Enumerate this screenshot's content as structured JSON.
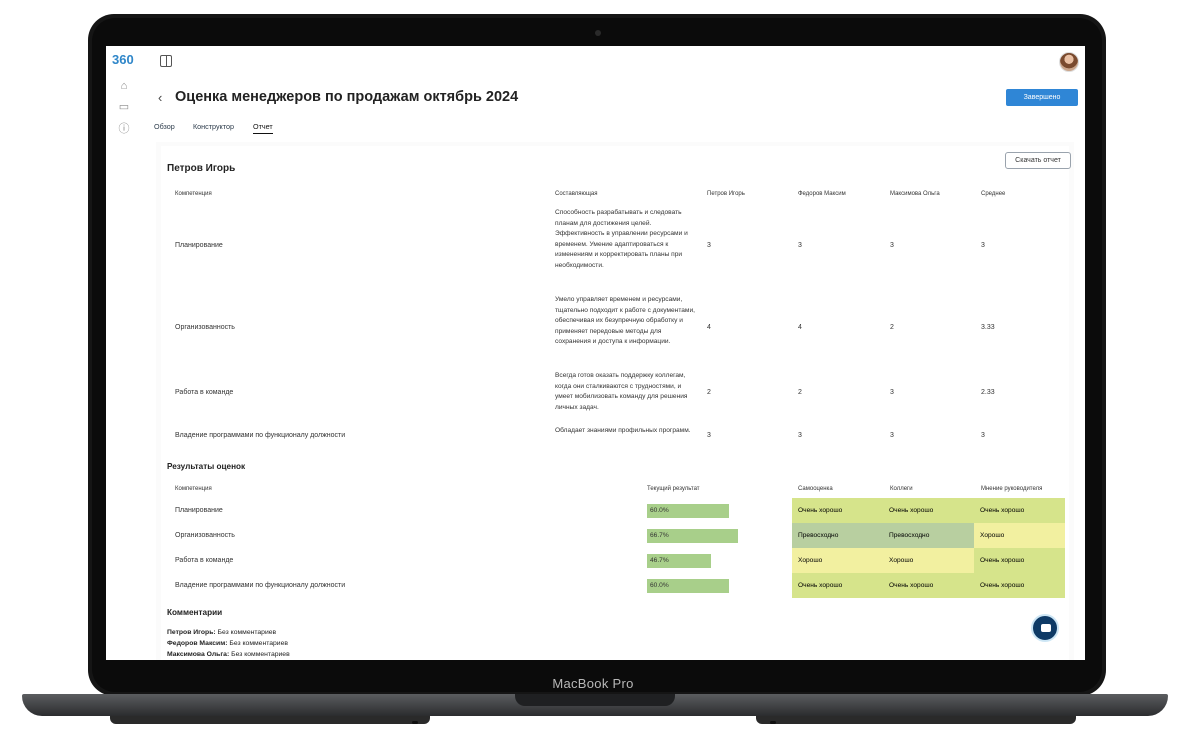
{
  "app": {
    "logo": "360",
    "title": "Оценка менеджеров по продажам октябрь 2024",
    "status_button": "Завершено"
  },
  "tabs": [
    {
      "label": "Обзор"
    },
    {
      "label": "Конструктор"
    },
    {
      "label": "Отчет"
    }
  ],
  "report": {
    "person": "Петров Игорь",
    "download_button": "Скачать отчет",
    "headers": [
      "Компетенция",
      "Составляющая",
      "Петров Игорь",
      "Федоров Максим",
      "Максимова Ольга",
      "Среднее"
    ],
    "rows": [
      {
        "competence": "Планирование",
        "desc": "Способность разрабатывать и следовать планам для достижения целей. Эффективность в управлении ресурсами и временем. Умение адаптироваться к изменениям и корректировать планы при необходимости.",
        "petrov": "3",
        "fedorov": "3",
        "maksimova": "3",
        "avg": "3"
      },
      {
        "competence": "Организованность",
        "desc": "Умело управляет временем и ресурсами, тщательно подходит к работе с документами, обеспечивая их безупречную обработку и применяет передовые методы для сохранения и доступа к информации.",
        "petrov": "4",
        "fedorov": "4",
        "maksimova": "2",
        "avg": "3.33"
      },
      {
        "competence": "Работа в команде",
        "desc": "Всегда готов оказать поддержку коллегам, когда они сталкиваются с трудностями, и умеет мобилизовать команду для решения личных задач.",
        "petrov": "2",
        "fedorov": "2",
        "maksimova": "3",
        "avg": "2.33"
      },
      {
        "competence": "Владение программами по функционалу должности",
        "desc": "Обладает знаниями профильных программ.",
        "petrov": "3",
        "fedorov": "3",
        "maksimova": "3",
        "avg": "3"
      }
    ]
  },
  "results": {
    "section_title": "Результаты оценок",
    "headers": [
      "Компетенция",
      "Текущий результат",
      "Самооценка",
      "Коллеги",
      "Мнение руководителя"
    ],
    "rows": [
      {
        "competence": "Планирование",
        "current": "60.0%",
        "current_value": 60.0,
        "self": "Очень хорошо",
        "peers": "Очень хорошо",
        "manager": "Очень хорошо"
      },
      {
        "competence": "Организованность",
        "current": "66.7%",
        "current_value": 66.7,
        "self": "Превосходно",
        "peers": "Превосходно",
        "manager": "Хорошо"
      },
      {
        "competence": "Работа в команде",
        "current": "46.7%",
        "current_value": 46.7,
        "self": "Хорошо",
        "peers": "Хорошо",
        "manager": "Очень хорошо"
      },
      {
        "competence": "Владение программами по функционалу должности",
        "current": "60.0%",
        "current_value": 60.0,
        "self": "Очень хорошо",
        "peers": "Очень хорошо",
        "manager": "Очень хорошо"
      }
    ],
    "colors": {
      "Очень хорошо": "#d6e48b",
      "Превосходно": "#b8cfa0",
      "Хорошо": "#f2f0a0",
      "bar": "#a8cf8a"
    }
  },
  "comments": {
    "section_title": "Комментарии",
    "items": [
      {
        "name": "Петров Игорь:",
        "text": "Без комментариев"
      },
      {
        "name": "Федоров Максим:",
        "text": "Без комментариев"
      },
      {
        "name": "Максимова Ольга:",
        "text": "Без комментариев"
      }
    ]
  },
  "device": {
    "label": "MacBook Pro"
  }
}
